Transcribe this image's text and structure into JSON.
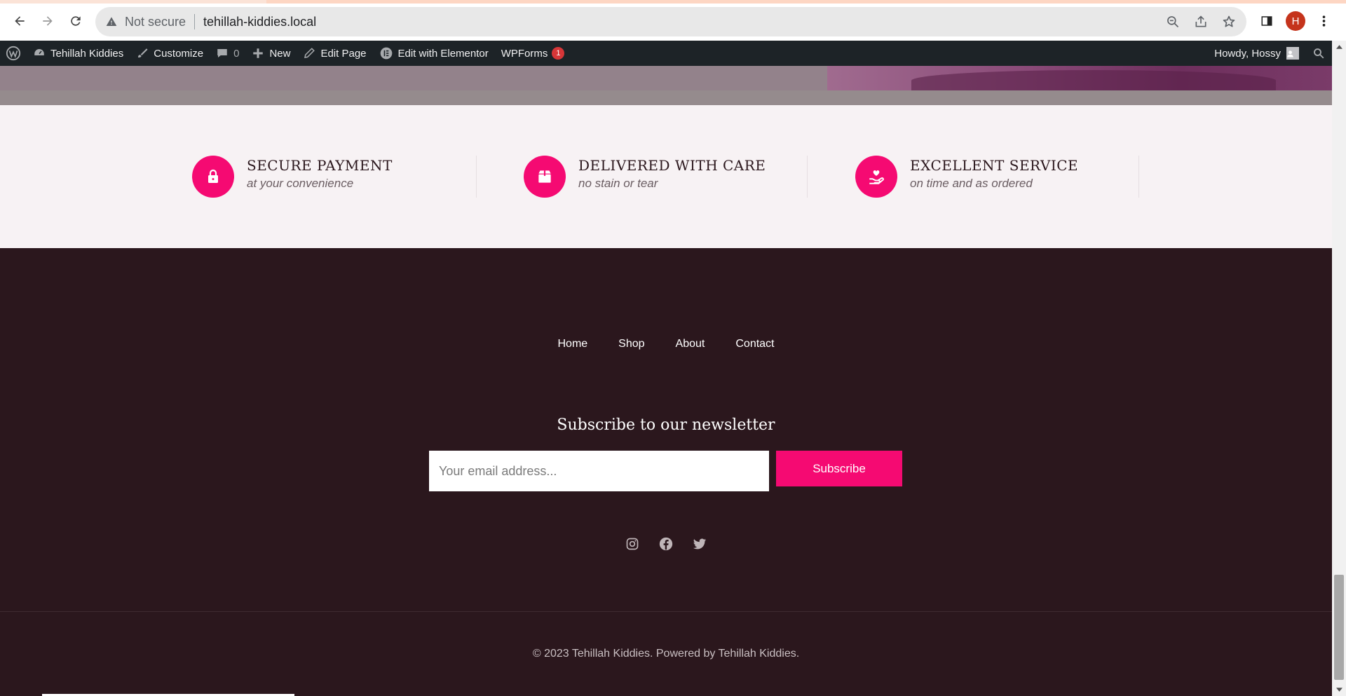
{
  "browser": {
    "security_label": "Not secure",
    "url": "tehillah-kiddies.local",
    "profile_initial": "H"
  },
  "adminbar": {
    "site_name": "Tehillah Kiddies",
    "customize": "Customize",
    "comments_count": "0",
    "new": "New",
    "edit_page": "Edit Page",
    "edit_elementor": "Edit with Elementor",
    "wpforms": "WPForms",
    "wpforms_badge": "1",
    "howdy": "Howdy, Hossy"
  },
  "features": [
    {
      "title": "SECURE PAYMENT",
      "subtitle": "at your convenience",
      "icon": "lock-icon"
    },
    {
      "title": "DELIVERED WITH CARE",
      "subtitle": "no stain or tear",
      "icon": "box-icon"
    },
    {
      "title": "EXCELLENT SERVICE",
      "subtitle": "on time and as ordered",
      "icon": "hand-heart-icon"
    }
  ],
  "footer": {
    "nav": [
      "Home",
      "Shop",
      "About",
      "Contact"
    ],
    "newsletter_title": "Subscribe to our newsletter",
    "email_placeholder": "Your email address...",
    "subscribe_label": "Subscribe",
    "socials": [
      "instagram-icon",
      "facebook-icon",
      "twitter-icon"
    ],
    "copyright": "© 2023 Tehillah Kiddies. Powered by Tehillah Kiddies."
  },
  "colors": {
    "accent": "#f50a72",
    "footer_bg": "#2b171d",
    "features_bg": "#f7f2f4",
    "adminbar_bg": "#1d2327"
  }
}
